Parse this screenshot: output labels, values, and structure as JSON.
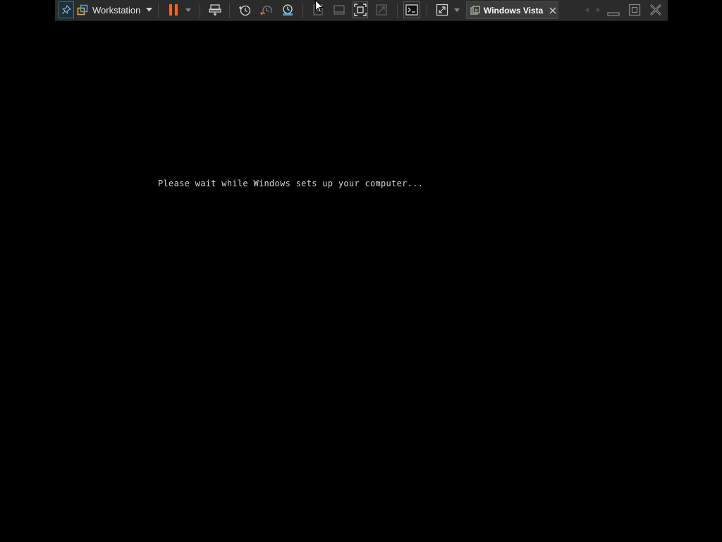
{
  "toolbar": {
    "product_label": "Workstation",
    "vm_tab": {
      "label": "Windows Vista"
    },
    "icons": {
      "pin": "pin-icon",
      "product_logo": "vmware-logo-icon",
      "pause": "pause-icon",
      "send_ctrl_alt_del": "send-keys-icon",
      "snapshot": "snapshot-icon",
      "revert_snapshot": "revert-snapshot-icon",
      "snapshot_manager": "snapshot-manager-icon",
      "unity": "unity-icon",
      "library": "library-icon",
      "full_screen": "full-screen-icon",
      "fit": "fit-window-icon",
      "console": "console-view-icon",
      "stretch": "stretch-icon",
      "close_tab": "close-icon",
      "minimize": "minimize-icon",
      "restore": "restore-icon",
      "close_window": "close-window-icon"
    },
    "colors": {
      "accent_orange": "#f26522",
      "accent_blue": "#4a9fd8",
      "background": "#2b2b2b"
    }
  },
  "console": {
    "message": "Please wait while Windows sets up your computer...",
    "background": "#000000"
  }
}
